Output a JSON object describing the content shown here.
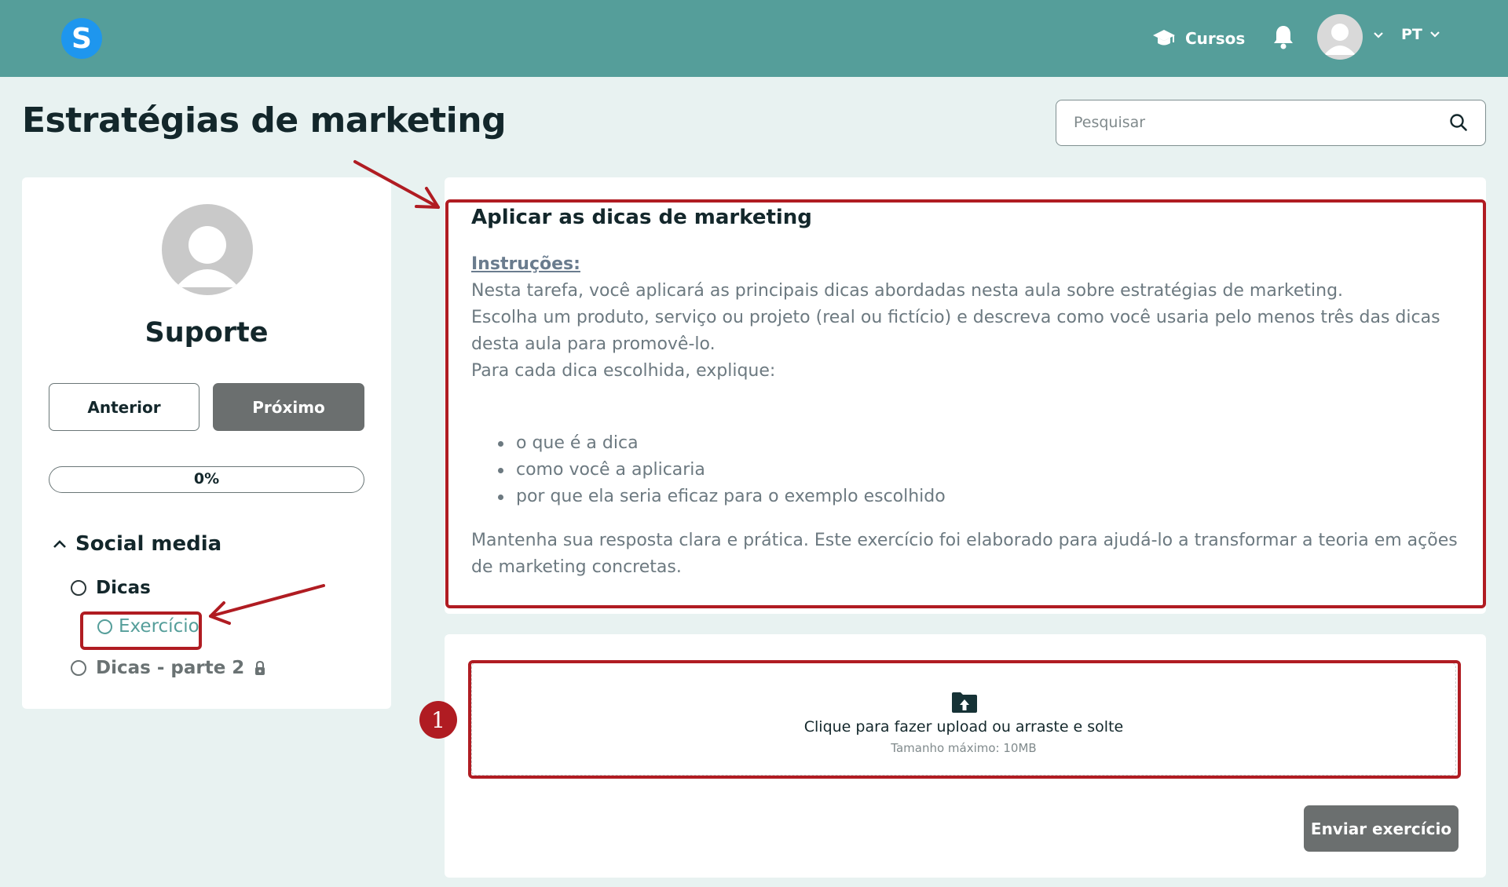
{
  "header": {
    "logo_letter": "S",
    "nav_courses_label": "Cursos",
    "language_label": "PT"
  },
  "page": {
    "title": "Estratégias de marketing"
  },
  "search": {
    "placeholder": "Pesquisar"
  },
  "sidebar": {
    "user_name": "Suporte",
    "prev_label": "Anterior",
    "next_label": "Próximo",
    "progress_label": "0%",
    "progress_value": 0,
    "section_title": "Social media",
    "items": [
      {
        "label": "Dicas",
        "state": "incomplete"
      },
      {
        "label": "Exercício",
        "state": "current"
      },
      {
        "label": "Dicas - parte 2",
        "state": "locked"
      }
    ]
  },
  "task": {
    "title": "Aplicar as dicas de marketing",
    "instructions_label": "Instruções:",
    "paragraphs": [
      "Nesta tarefa, você aplicará as principais dicas abordadas nesta aula sobre estratégias de marketing.",
      "Escolha um produto, serviço ou projeto (real ou fictício) e descreva como você usaria pelo menos três das dicas desta aula para promovê-lo.",
      "Para cada dica escolhida, explique:"
    ],
    "bullets": [
      "o que é a dica",
      "como você a aplicaria",
      "por que ela seria eficaz para o exemplo escolhido"
    ],
    "closing": "Mantenha sua resposta clara e prática. Este exercício foi elaborado para ajudá-lo a transformar a teoria em ações de marketing concretas."
  },
  "upload": {
    "main_text": "Clique para fazer upload ou arraste e solte",
    "sub_text": "Tamanho máximo: 10MB",
    "submit_label": "Enviar exercício"
  },
  "annotations": {
    "step_badge": "1",
    "highlight_color": "#b01c22"
  },
  "colors": {
    "topbar": "#559e9a",
    "accent": "#559e9a",
    "logo": "#1e96ee",
    "button_dark": "#6b6f6f",
    "page_bg": "#e8f2f1"
  }
}
